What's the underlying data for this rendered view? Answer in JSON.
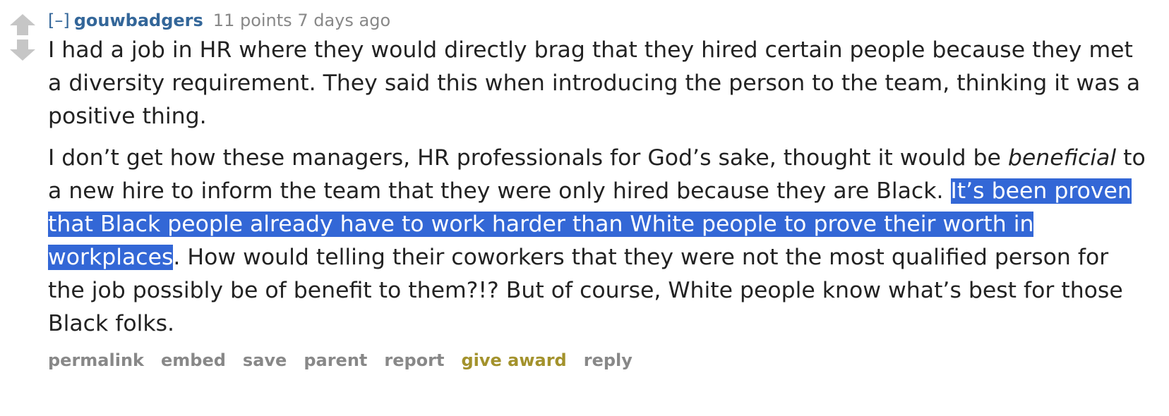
{
  "comment": {
    "expand_label": "[–]",
    "author": "gouwbadgers",
    "score": "11 points",
    "time": "7 days ago",
    "body": {
      "p1": "I had a job in HR where they would directly brag that they hired certain people because they met a diversity requirement. They said this when introducing the person to the team, thinking it was a positive thing.",
      "p2_a": "I don’t get how these managers, HR professionals for God’s sake, thought it would be ",
      "p2_em": "beneficial",
      "p2_b": " to a new hire to inform the team that they were only hired because they are Black. ",
      "p2_highlight": "It’s been proven that Black people already have to work harder than White people to prove their worth in workplaces",
      "p2_c": ". How would telling their coworkers that they were not the most qualified person for the job possibly be of benefit to them?!? But of course, White people know what’s best for those Black folks."
    },
    "actions": {
      "permalink": "permalink",
      "embed": "embed",
      "save": "save",
      "parent": "parent",
      "report": "report",
      "give_award": "give award",
      "reply": "reply"
    }
  },
  "icons": {
    "upvote": "upvote-arrow-icon",
    "downvote": "downvote-arrow-icon"
  },
  "colors": {
    "link_blue": "#336699",
    "meta_gray": "#888888",
    "text": "#222222",
    "selection": "#3367d6",
    "award_gold": "#a3922c",
    "arrow_gray": "#c6c6c6"
  }
}
